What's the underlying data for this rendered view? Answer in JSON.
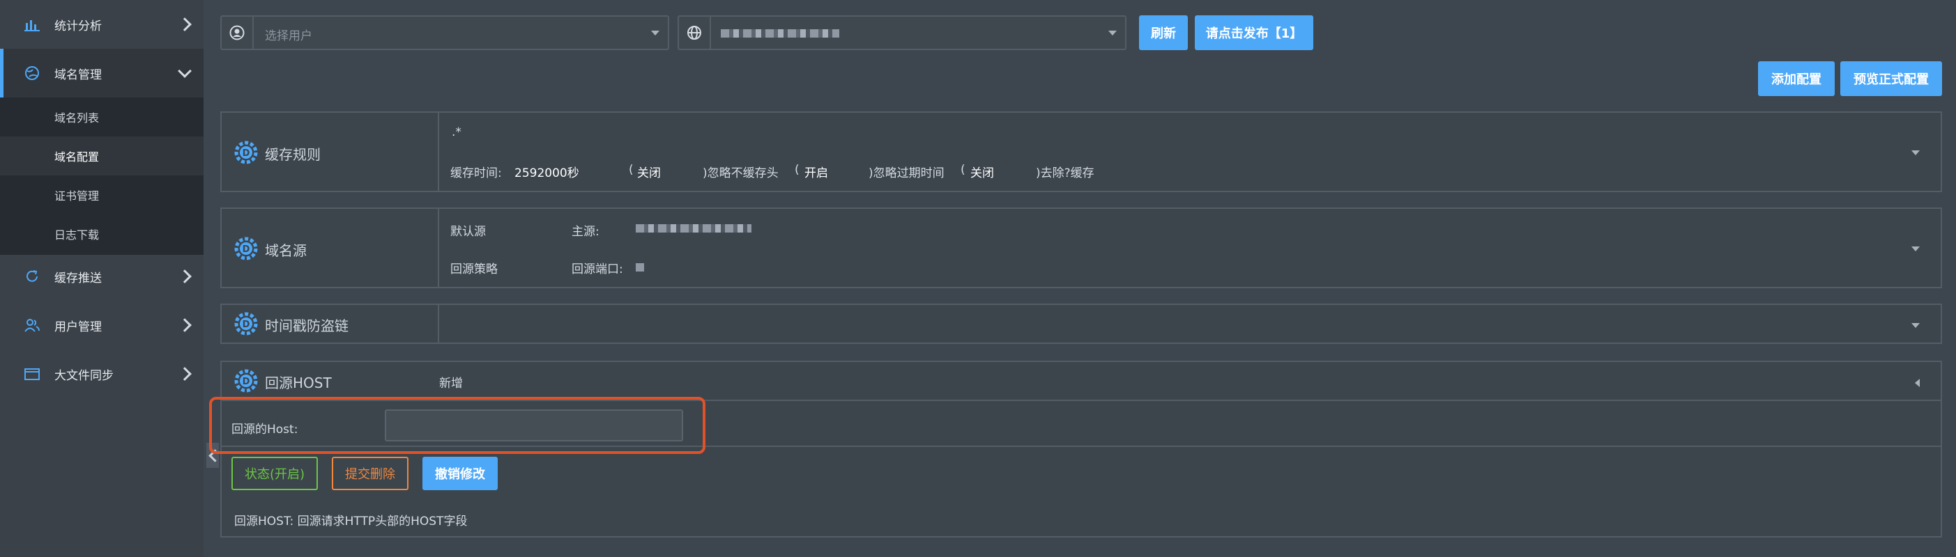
{
  "sidebar": {
    "items": [
      {
        "label": "统计分析",
        "icon": "bar-chart-icon"
      },
      {
        "label": "域名管理",
        "icon": "globe-icon",
        "expanded": true
      },
      {
        "label": "缓存推送",
        "icon": "refresh-icon"
      },
      {
        "label": "用户管理",
        "icon": "users-icon"
      },
      {
        "label": "大文件同步",
        "icon": "folder-icon"
      }
    ],
    "submenu": [
      "域名列表",
      "域名配置",
      "证书管理",
      "日志下载"
    ],
    "selected_submenu": "域名配置"
  },
  "toolbar": {
    "user_select_placeholder": "选择用户",
    "refresh_label": "刷新",
    "publish_label": "请点击发布【1】",
    "add_config_label": "添加配置",
    "preview_label": "预览正式配置"
  },
  "panels": {
    "cache": {
      "title": "缓存规则",
      "pattern": ".*",
      "ttl_label": "缓存时间:",
      "ttl_value": "2592000秒",
      "paren1": "(",
      "close1": "关闭",
      "ignore_header": ")忽略不缓存头",
      "paren2": "(",
      "open2": "开启",
      "ignore_expire": ")忽略过期时间",
      "paren3": "(",
      "close3": "关闭",
      "remove_q": ")去除?缓存"
    },
    "origin": {
      "title": "域名源",
      "default_label": "默认源",
      "main_label": "主源:",
      "strategy_label": "回源策略",
      "port_label": "回源端口:"
    },
    "timestamp": {
      "title": "时间戳防盗链"
    },
    "host": {
      "title": "回源HOST",
      "new_label": "新增",
      "host_field_label": "回源的Host:",
      "status_button": "状态(开启)",
      "delete_button": "提交删除",
      "revert_button": "撤销修改",
      "description": "回源HOST: 回源请求HTTP头部的HOST字段"
    }
  },
  "colors": {
    "accent": "#4ea8f8",
    "status_green": "#6cc644",
    "delete_orange": "#f0883e",
    "highlight_red": "#e0532a"
  }
}
